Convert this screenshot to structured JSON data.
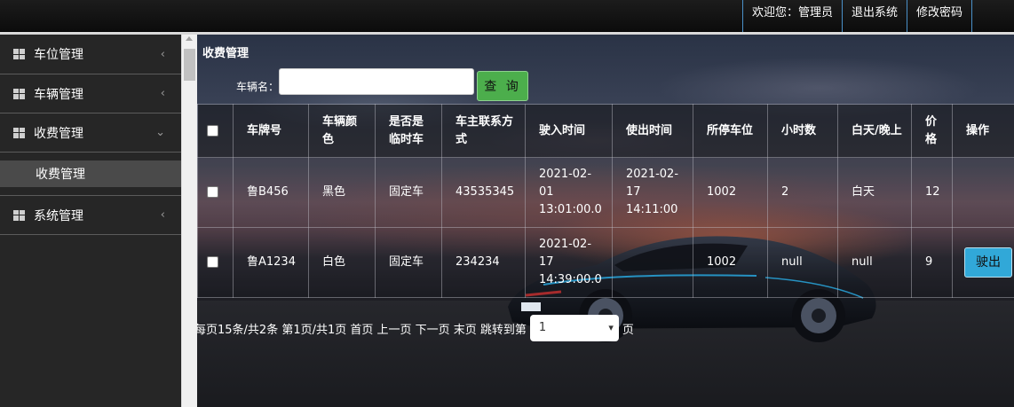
{
  "topbar": {
    "welcome": "欢迎您：管理员",
    "logout": "退出系统",
    "change_password": "修改密码"
  },
  "sidebar": {
    "items": [
      {
        "label": "车位管理",
        "chevron": "‹"
      },
      {
        "label": "车辆管理",
        "chevron": "‹"
      },
      {
        "label": "收费管理",
        "chevron": "⌄"
      },
      {
        "label": "系统管理",
        "chevron": "‹"
      }
    ],
    "submenu": {
      "label": "收费管理"
    },
    "icon": "grid-icon"
  },
  "main": {
    "title": "收费管理",
    "search": {
      "label": "车辆名：",
      "value": "",
      "button": "查 询"
    },
    "table": {
      "headers": [
        "车牌号",
        "车辆颜色",
        "是否是临时车",
        "车主联系方式",
        "驶入时间",
        "使出时间",
        "所停车位",
        "小时数",
        "白天/晚上",
        "价格",
        "操作"
      ],
      "rows": [
        {
          "plate": "鲁B456",
          "color": "黑色",
          "temp": "固定车",
          "phone": "43535345",
          "in_time": "2021-02-01 13:01:00.0",
          "out_time": "2021-02-17 14:11:00",
          "space": "1002",
          "hours": "2",
          "day_night": "白天",
          "price": "12",
          "action": ""
        },
        {
          "plate": "鲁A1234",
          "color": "白色",
          "temp": "固定车",
          "phone": "234234",
          "in_time": "2021-02-17 14:39:00.0",
          "out_time": "",
          "space": "1002",
          "hours": "null",
          "day_night": "null",
          "price": "9",
          "action": "驶出"
        }
      ]
    },
    "pager": {
      "text": "每页15条/共2条 第1页/共1页 首页 上一页 下一页 末页 跳转到第",
      "selected_page": "1",
      "suffix": "页"
    }
  }
}
